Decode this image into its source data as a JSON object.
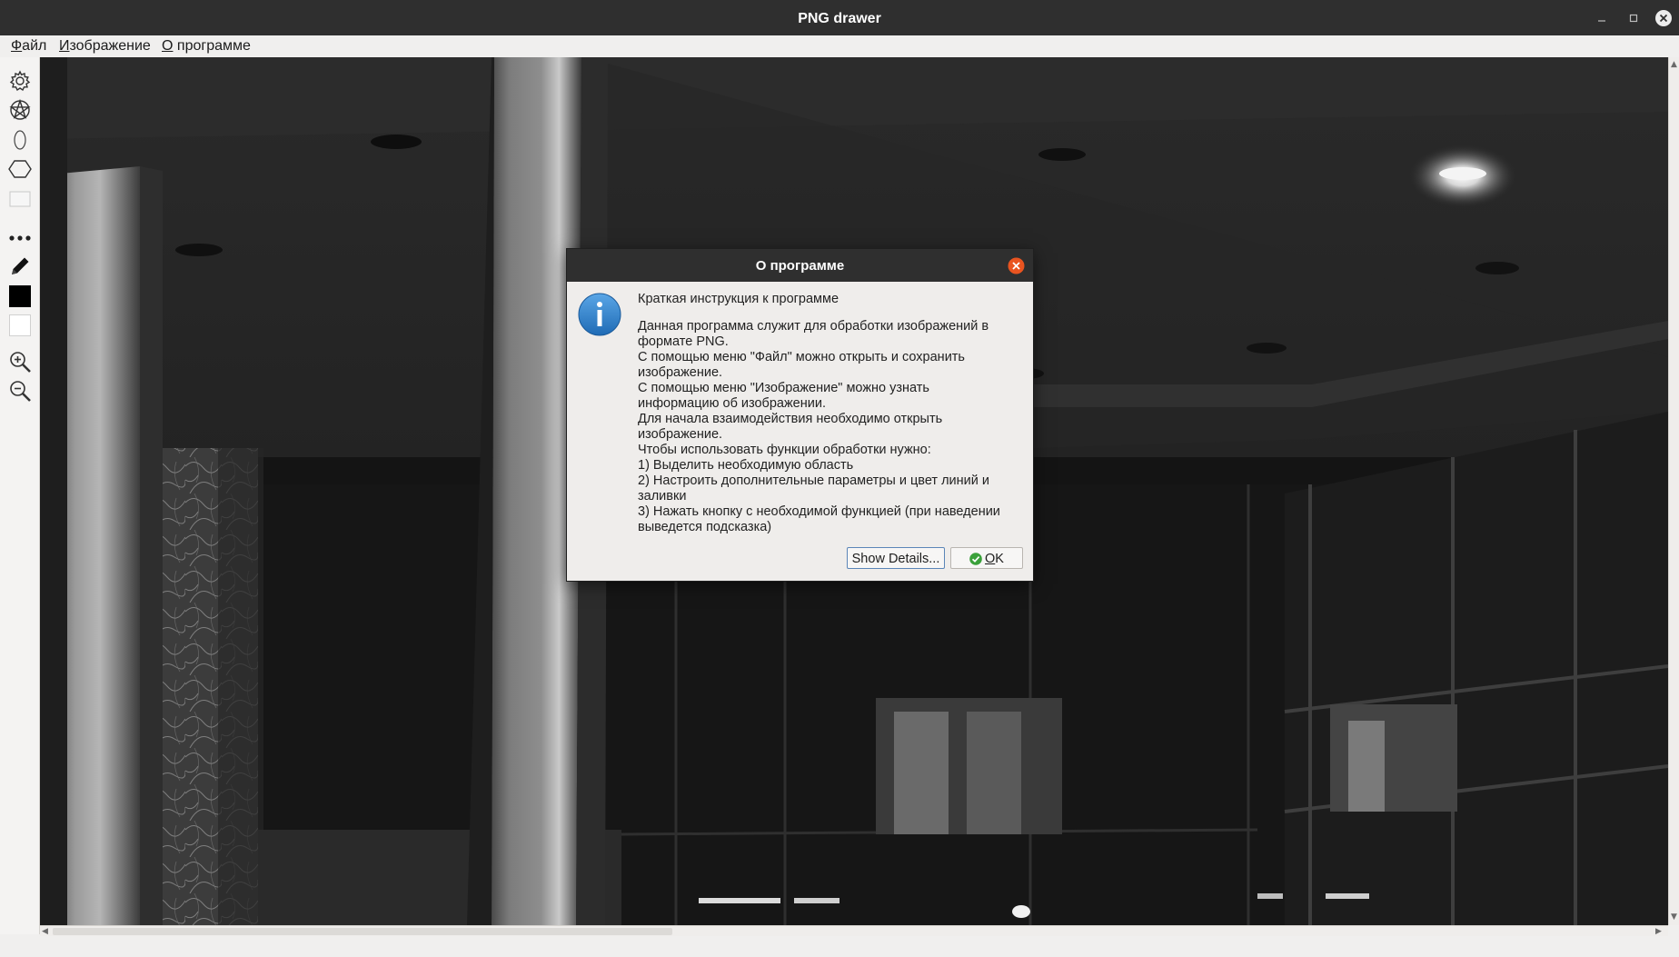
{
  "window": {
    "title": "PNG drawer",
    "controls": [
      "minimize-icon",
      "maximize-icon",
      "close-icon"
    ]
  },
  "menu": {
    "items": [
      {
        "mnemonic": "Ф",
        "rest": "айл"
      },
      {
        "mnemonic": "И",
        "rest": "зображение"
      },
      {
        "mnemonic": "О",
        "rest": " программе"
      }
    ]
  },
  "toolbar": {
    "tools": [
      "gear-icon",
      "pentagram-circle-icon",
      "ellipse-icon",
      "hexagon-icon",
      "rectangle-icon",
      "more-icon",
      "pencil-icon",
      "line-color-swatch",
      "fill-color-swatch",
      "zoom-in-icon",
      "zoom-out-icon"
    ],
    "line_color": "#000000",
    "fill_color": "#ffffff"
  },
  "dialog": {
    "title": "О программе",
    "icon": "information-icon",
    "heading": "Краткая инструкция к программе",
    "lines": [
      "Данная программа служит для обработки изображений в",
      "формате PNG.",
      "С помощью меню \"Файл\" можно открыть и сохранить",
      "изображение.",
      "С помощью меню \"Изображение\" можно узнать",
      "информацию об изображении.",
      "Для начала взаимодействия необходимо открыть",
      "изображение.",
      "Чтобы использовать функции обработки нужно:",
      "1) Выделить необходимую область",
      "2) Настроить дополнительные параметры и цвет линий и",
      "заливки",
      "3) Нажать кнопку с необходимой функцией (при наведении",
      "выведется подсказка)"
    ],
    "details_button": "Show Details...",
    "ok_button": {
      "mnemonic": "O",
      "rest": "K"
    }
  },
  "colors": {
    "titlebar": "#2f2f2f",
    "close_orange": "#e95420",
    "info_blue": "#2d7dc8",
    "ok_green": "#3aa03a"
  }
}
